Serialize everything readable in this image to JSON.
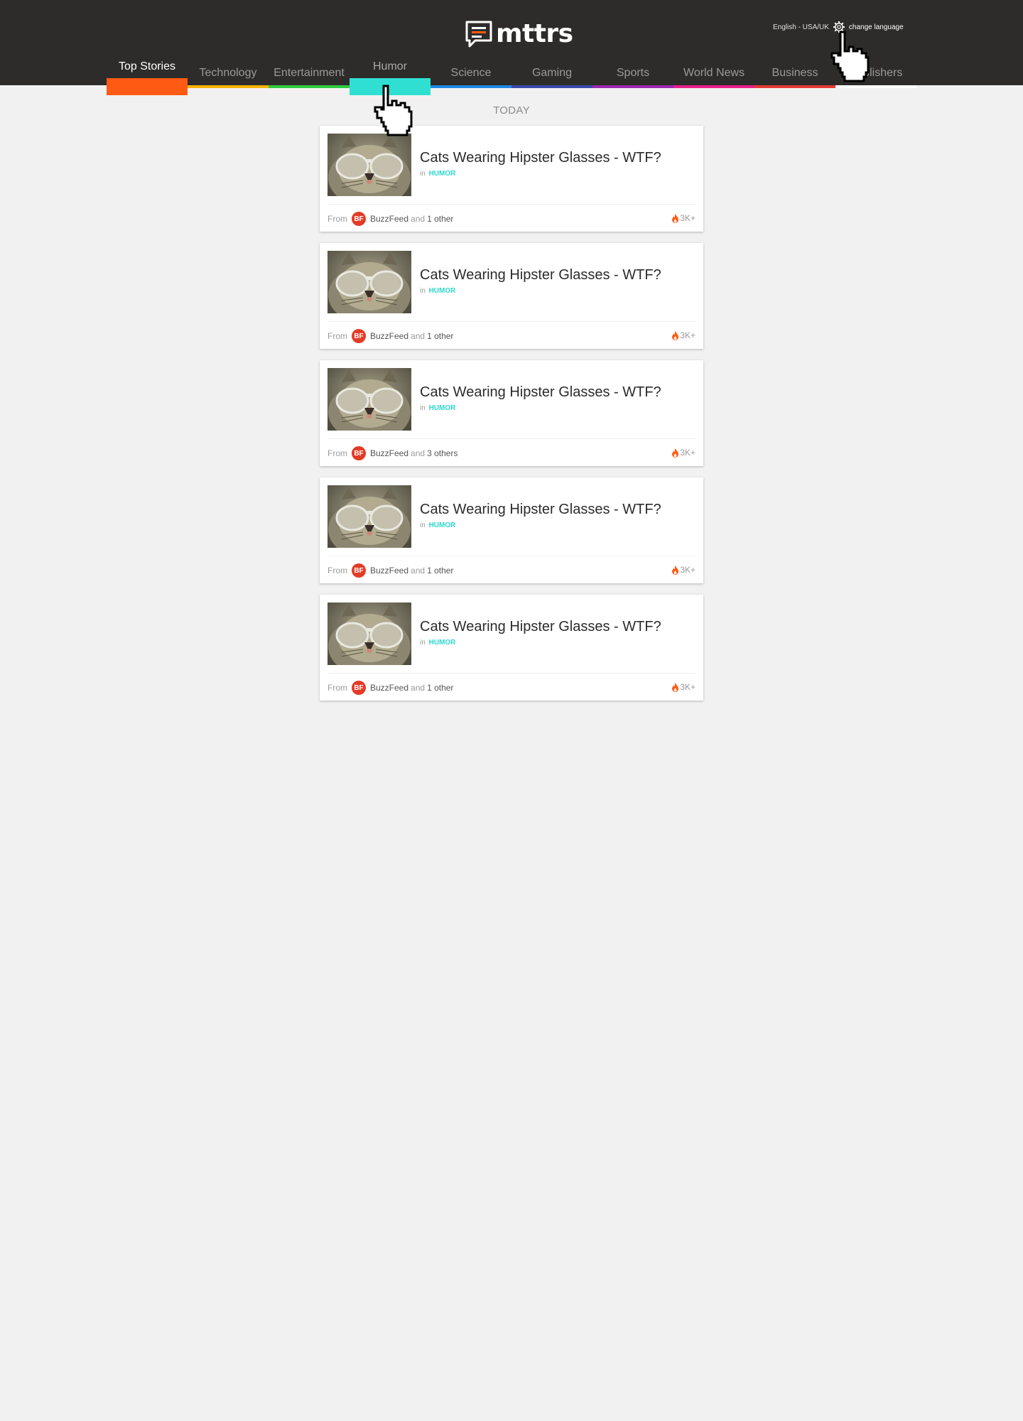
{
  "brand": {
    "name": "mttrs",
    "accent": "#ff5a14"
  },
  "language": {
    "current": "English - USA/UK",
    "change_label": "change language"
  },
  "nav": [
    {
      "label": "Top Stories",
      "color": "#ff5a14",
      "state": "active"
    },
    {
      "label": "Technology",
      "color": "#ffb400",
      "state": ""
    },
    {
      "label": "Entertainment",
      "color": "#2ecc40",
      "state": ""
    },
    {
      "label": "Humor",
      "color": "#2fe0d2",
      "state": "hover"
    },
    {
      "label": "Science",
      "color": "#1e88e5",
      "state": ""
    },
    {
      "label": "Gaming",
      "color": "#3949ab",
      "state": ""
    },
    {
      "label": "Sports",
      "color": "#9c27b0",
      "state": ""
    },
    {
      "label": "World News",
      "color": "#e91e8c",
      "state": ""
    },
    {
      "label": "Business",
      "color": "#e53935",
      "state": ""
    },
    {
      "label": "Publishers",
      "color": "#ffffff",
      "state": ""
    }
  ],
  "section": {
    "title": "TODAY"
  },
  "stories": [
    {
      "title": "Cats Wearing Hipster Glasses - WTF?",
      "in_label": "in",
      "category": "HUMOR",
      "from_label": "From",
      "badge": "BF",
      "publisher": "BuzzFeed",
      "and_label": "and",
      "others": "1 other",
      "hot": "3K+"
    },
    {
      "title": "Cats Wearing Hipster Glasses - WTF?",
      "in_label": "in",
      "category": "HUMOR",
      "from_label": "From",
      "badge": "BF",
      "publisher": "BuzzFeed",
      "and_label": "and",
      "others": "1 other",
      "hot": "3K+"
    },
    {
      "title": "Cats Wearing Hipster Glasses - WTF?",
      "in_label": "in",
      "category": "HUMOR",
      "from_label": "From",
      "badge": "BF",
      "publisher": "BuzzFeed",
      "and_label": "and",
      "others": "3 others",
      "hot": "3K+"
    },
    {
      "title": "Cats Wearing Hipster Glasses - WTF?",
      "in_label": "in",
      "category": "HUMOR",
      "from_label": "From",
      "badge": "BF",
      "publisher": "BuzzFeed",
      "and_label": "and",
      "others": "1 other",
      "hot": "3K+"
    },
    {
      "title": "Cats Wearing Hipster Glasses - WTF?",
      "in_label": "in",
      "category": "HUMOR",
      "from_label": "From",
      "badge": "BF",
      "publisher": "BuzzFeed",
      "and_label": "and",
      "others": "1 other",
      "hot": "3K+"
    }
  ]
}
